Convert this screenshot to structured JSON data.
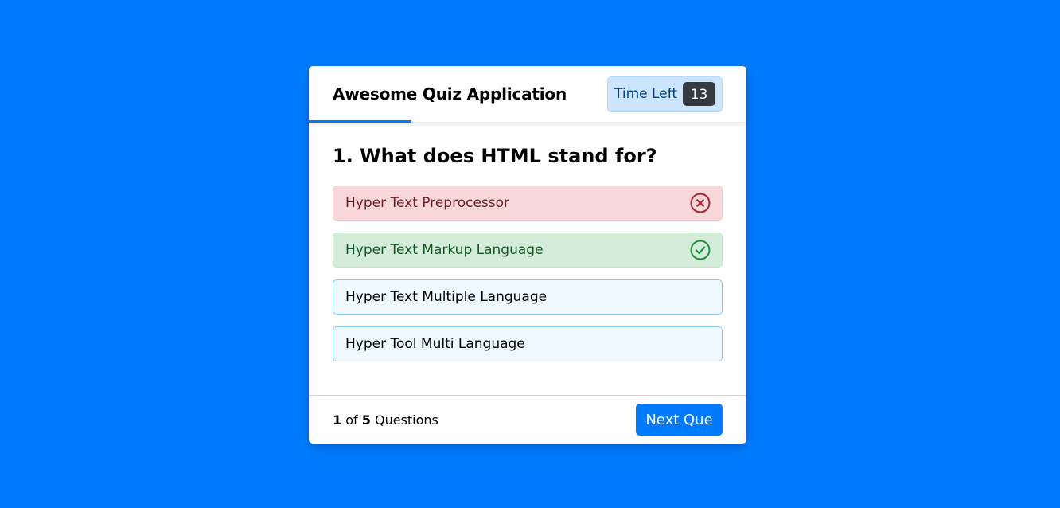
{
  "header": {
    "title": "Awesome Quiz Application",
    "timer_label": "Time Left",
    "timer_value": "13"
  },
  "question": {
    "text": "1. What does HTML stand for?"
  },
  "options": [
    {
      "label": "Hyper Text Preprocessor",
      "state": "incorrect",
      "icon": "cross-circle-icon"
    },
    {
      "label": "Hyper Text Markup Language",
      "state": "correct",
      "icon": "check-circle-icon"
    },
    {
      "label": "Hyper Text Multiple Language",
      "state": "neutral"
    },
    {
      "label": "Hyper Tool Multi Language",
      "state": "neutral"
    }
  ],
  "footer": {
    "current": "1",
    "of": "of",
    "total": "5",
    "questions_word": "Questions",
    "next_label": "Next Que"
  },
  "colors": {
    "background": "#007bff",
    "accent": "#007bff",
    "correct": "#155724",
    "incorrect": "#a42834",
    "timer_badge": "#343a40"
  }
}
